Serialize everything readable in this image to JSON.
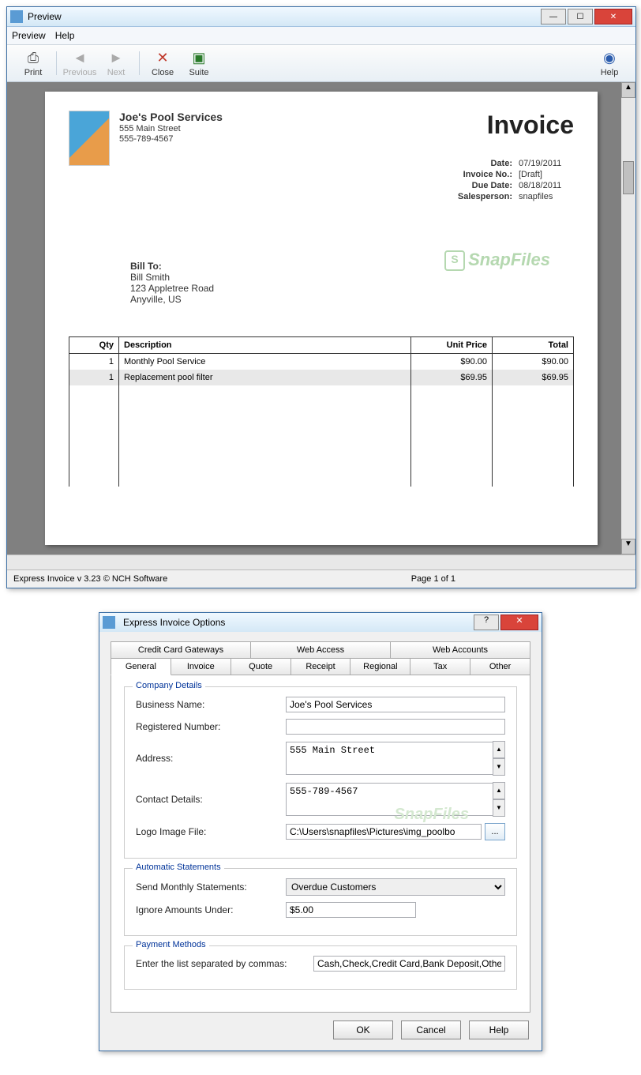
{
  "win1": {
    "title": "Preview",
    "menubar": [
      "Preview",
      "Help"
    ],
    "toolbar": {
      "print": "Print",
      "previous": "Previous",
      "next": "Next",
      "close": "Close",
      "suite": "Suite",
      "help": "Help"
    },
    "status_left": "Express Invoice v 3.23 © NCH Software",
    "status_mid": "Page 1 of 1"
  },
  "invoice": {
    "company": {
      "name": "Joe's Pool Services",
      "addr": "555 Main Street",
      "phone": "555-789-4567"
    },
    "title": "Invoice",
    "meta": {
      "date_lbl": "Date:",
      "date": "07/19/2011",
      "inv_lbl": "Invoice No.:",
      "inv": "[Draft]",
      "due_lbl": "Due Date:",
      "due": "08/18/2011",
      "sales_lbl": "Salesperson:",
      "sales": "snapfiles"
    },
    "billto": {
      "lbl": "Bill To:",
      "name": "Bill Smith",
      "addr": "123 Appletree Road",
      "city": "Anyville, US"
    },
    "cols": {
      "qty": "Qty",
      "desc": "Description",
      "unit": "Unit Price",
      "total": "Total"
    },
    "items": [
      {
        "qty": "1",
        "desc": "Monthly Pool Service",
        "unit": "$90.00",
        "total": "$90.00"
      },
      {
        "qty": "1",
        "desc": "Replacement pool filter",
        "unit": "$69.95",
        "total": "$69.95"
      }
    ],
    "watermark": "SnapFiles"
  },
  "win2": {
    "title": "Express Invoice Options",
    "tabs_top": [
      "Credit Card Gateways",
      "Web Access",
      "Web Accounts"
    ],
    "tabs_bot": [
      "General",
      "Invoice",
      "Quote",
      "Receipt",
      "Regional",
      "Tax",
      "Other"
    ],
    "g1": {
      "legend": "Company Details",
      "business_lbl": "Business Name:",
      "business": "Joe's Pool Services",
      "reg_lbl": "Registered Number:",
      "reg": "",
      "addr_lbl": "Address:",
      "addr": "555 Main Street",
      "contact_lbl": "Contact Details:",
      "contact": "555-789-4567",
      "logo_lbl": "Logo Image File:",
      "logo": "C:\\Users\\snapfiles\\Pictures\\img_poolbo",
      "browse": "..."
    },
    "g2": {
      "legend": "Automatic Statements",
      "send_lbl": "Send Monthly Statements:",
      "send": "Overdue Customers",
      "ignore_lbl": "Ignore Amounts Under:",
      "ignore": "$5.00"
    },
    "g3": {
      "legend": "Payment Methods",
      "list_lbl": "Enter the list separated by commas:",
      "list": "Cash,Check,Credit Card,Bank Deposit,Other"
    },
    "buttons": {
      "ok": "OK",
      "cancel": "Cancel",
      "help": "Help"
    }
  }
}
